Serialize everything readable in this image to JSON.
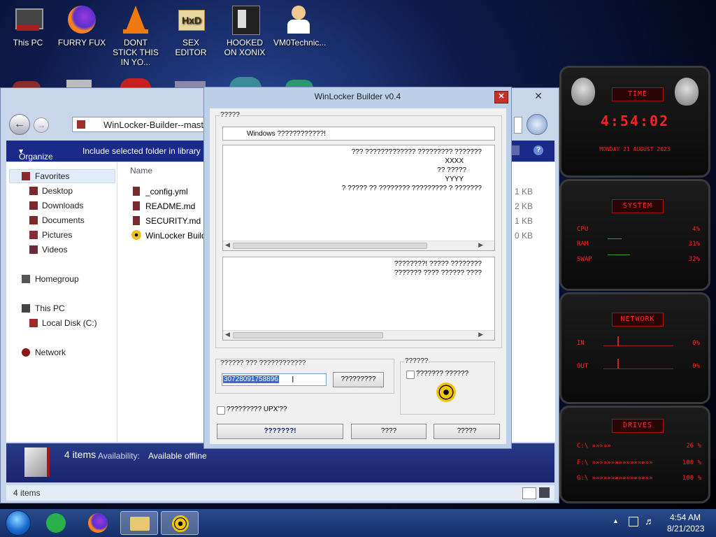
{
  "desktop": {
    "icons": [
      {
        "label": "This PC"
      },
      {
        "label": "FURRY FUX"
      },
      {
        "label": "DONT STICK THIS IN YO..."
      },
      {
        "label": "SEX EDITOR"
      },
      {
        "label": "HOOKED ON XONIX"
      },
      {
        "label": "VM0Technic..."
      }
    ]
  },
  "explorer": {
    "address": "WinLocker-Builder--mast",
    "toolbar": {
      "organize": "Organize",
      "include": "Include selected folder in library"
    },
    "nav": {
      "favorites": "Favorites",
      "desktop": "Desktop",
      "downloads": "Downloads",
      "documents": "Documents",
      "pictures": "Pictures",
      "videos": "Videos",
      "homegroup": "Homegroup",
      "thispc": "This PC",
      "localdisk": "Local Disk (C:)",
      "network": "Network"
    },
    "column_name": "Name",
    "files": [
      {
        "name": "_config.yml",
        "size": "1 KB"
      },
      {
        "name": "README.md",
        "size": "2 KB"
      },
      {
        "name": "SECURITY.md",
        "size": "1 KB"
      },
      {
        "name": "WinLocker Builde",
        "size": "0 KB"
      }
    ],
    "details": {
      "count": "4 items",
      "availability_label": "Availability:",
      "availability_value": "Available offline"
    },
    "status": "4 items"
  },
  "dialog": {
    "title": "WinLocker Builder v0.4",
    "group1_label": "?????",
    "caption_text": "Windows ????????????!",
    "message_lines": [
      "??? ????????????? ????????? ???????",
      "XXXX",
      "?? ?????",
      "YYYY",
      "? ????? ?? ???????? ????????? ? ???????"
    ],
    "message2_lines": [
      "????????! ????? ????????",
      "??????? ???? ?????? ????"
    ],
    "code_group_label": "?????? ??? ????????????",
    "code_value": "30728091758896",
    "generate_button": "?????????",
    "right_group_label": "??????",
    "right_checkbox_label": "??????? ??????",
    "upx_label": "????????? UPX'??",
    "build_button": "???????!",
    "button2": "????",
    "button3": "?????"
  },
  "gadget": {
    "time_title": "TIME",
    "time": "4:54:02",
    "date": "MONDAY 21 AUGUST 2023",
    "system_title": "SYSTEM",
    "cpu_label": "CPU",
    "cpu_value": "4%",
    "ram_label": "RAM",
    "ram_value": "31%",
    "swap_label": "SWAP",
    "swap_value": "32%",
    "network_title": "NETWORK",
    "in_label": "IN",
    "in_value": "0%",
    "out_label": "OUT",
    "out_value": "0%",
    "drives_title": "DRIVES",
    "drives": [
      {
        "label": "C:\\ »»»»»",
        "value": "26 %"
      },
      {
        "label": "F:\\ »»»»»»»»»»»»»»»»",
        "value": "100 %"
      },
      {
        "label": "G:\\ »»»»»»»»»»»»»»»»",
        "value": "100 %"
      }
    ]
  },
  "taskbar": {
    "time": "4:54 AM",
    "date": "8/21/2023"
  }
}
